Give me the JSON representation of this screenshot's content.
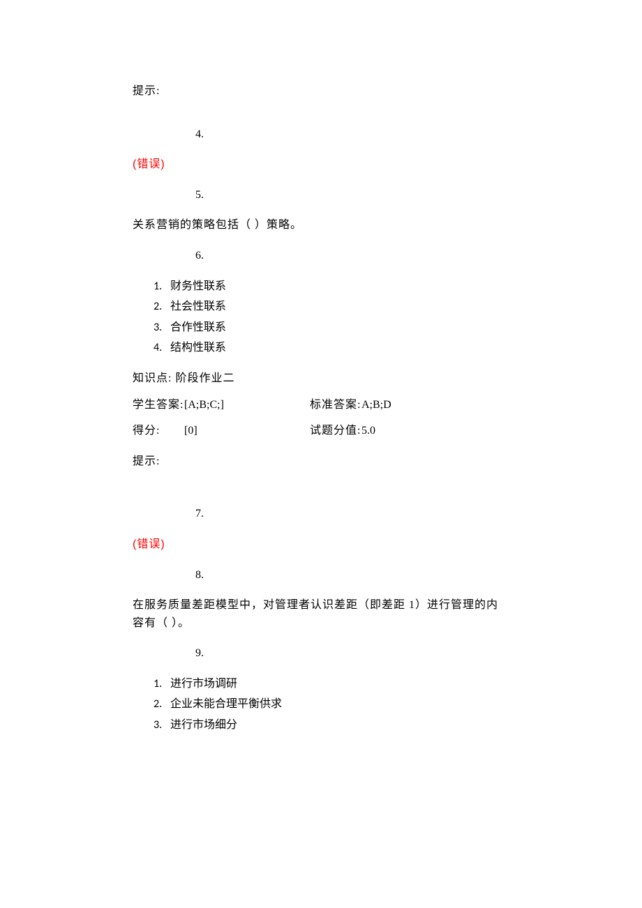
{
  "hint_label_1": "提示:",
  "number_4": "4.",
  "error_1": "(错误)",
  "number_5": "5.",
  "q1": {
    "text": "关系营销的策略包括（  ）策略。"
  },
  "number_6": "6.",
  "q1_options": {
    "n1": "1.",
    "o1": "财务性联系",
    "n2": "2.",
    "o2": "社会性联系",
    "n3": "3.",
    "o3": "合作性联系",
    "n4": "4.",
    "o4": "结构性联系"
  },
  "knowledge": {
    "label": "知识点:",
    "value": "阶段作业二"
  },
  "student_answer": {
    "label": "学生答案:",
    "value": "[A;B;C;]"
  },
  "standard_answer": {
    "label": "标准答案:",
    "value": "A;B;D"
  },
  "score": {
    "label": "得分:",
    "value": "[0]"
  },
  "question_score": {
    "label": "试题分值:",
    "value": "5.0"
  },
  "hint_label_2": "提示:",
  "number_7": "7.",
  "error_2": "(错误)",
  "number_8": "8.",
  "q2": {
    "text": "在服务质量差距模型中，对管理者认识差距（即差距 1）进行管理的内容有（  ）。"
  },
  "number_9": "9.",
  "q2_options": {
    "n1": "1.",
    "o1": "进行市场调研",
    "n2": "2.",
    "o2": "企业未能合理平衡供求",
    "n3": "3.",
    "o3": "进行市场细分"
  }
}
